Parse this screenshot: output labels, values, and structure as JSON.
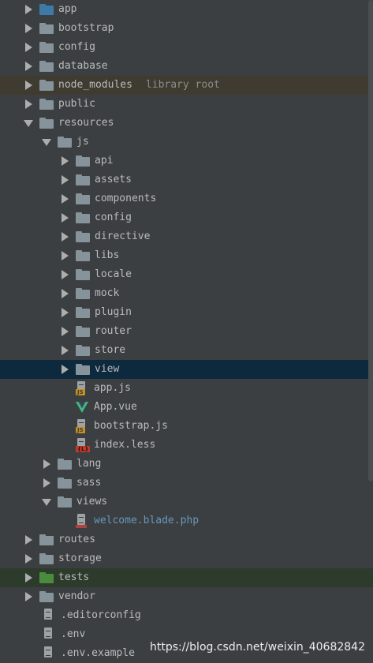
{
  "tree": [
    {
      "label": "app",
      "type": "folder",
      "color": "#3d7aa8",
      "expanded": false
    },
    {
      "label": "bootstrap",
      "type": "folder",
      "color": "#87939a",
      "expanded": false
    },
    {
      "label": "config",
      "type": "folder",
      "color": "#87939a",
      "expanded": false
    },
    {
      "label": "database",
      "type": "folder",
      "color": "#87939a",
      "expanded": false
    },
    {
      "label": "node_modules",
      "hint": "library root",
      "type": "folder",
      "color": "#87939a",
      "expanded": false
    },
    {
      "label": "public",
      "type": "folder",
      "color": "#87939a",
      "expanded": false
    },
    {
      "label": "resources",
      "type": "folder",
      "color": "#87939a",
      "expanded": true
    },
    {
      "label": "js",
      "type": "folder",
      "color": "#87939a",
      "expanded": true
    },
    {
      "label": "api",
      "type": "folder",
      "color": "#87939a",
      "expanded": false
    },
    {
      "label": "assets",
      "type": "folder",
      "color": "#87939a",
      "expanded": false
    },
    {
      "label": "components",
      "type": "folder",
      "color": "#87939a",
      "expanded": false
    },
    {
      "label": "config",
      "type": "folder",
      "color": "#87939a",
      "expanded": false
    },
    {
      "label": "directive",
      "type": "folder",
      "color": "#87939a",
      "expanded": false
    },
    {
      "label": "libs",
      "type": "folder",
      "color": "#87939a",
      "expanded": false
    },
    {
      "label": "locale",
      "type": "folder",
      "color": "#87939a",
      "expanded": false
    },
    {
      "label": "mock",
      "type": "folder",
      "color": "#87939a",
      "expanded": false
    },
    {
      "label": "plugin",
      "type": "folder",
      "color": "#87939a",
      "expanded": false
    },
    {
      "label": "router",
      "type": "folder",
      "color": "#87939a",
      "expanded": false
    },
    {
      "label": "store",
      "type": "folder",
      "color": "#87939a",
      "expanded": false
    },
    {
      "label": "view",
      "type": "folder",
      "color": "#87939a",
      "expanded": false
    },
    {
      "label": "app.js",
      "type": "file",
      "icon": "js-file-icon"
    },
    {
      "label": "App.vue",
      "type": "file",
      "icon": "vue-file-icon"
    },
    {
      "label": "bootstrap.js",
      "type": "file",
      "icon": "js-file-icon"
    },
    {
      "label": "index.less",
      "type": "file",
      "icon": "less-file-icon"
    },
    {
      "label": "lang",
      "type": "folder",
      "color": "#87939a",
      "expanded": false
    },
    {
      "label": "sass",
      "type": "folder",
      "color": "#87939a",
      "expanded": false
    },
    {
      "label": "views",
      "type": "folder",
      "color": "#87939a",
      "expanded": true
    },
    {
      "label": "welcome.blade.php",
      "type": "file",
      "icon": "php-file-icon"
    },
    {
      "label": "routes",
      "type": "folder",
      "color": "#87939a",
      "expanded": false
    },
    {
      "label": "storage",
      "type": "folder",
      "color": "#87939a",
      "expanded": false
    },
    {
      "label": "tests",
      "type": "folder",
      "color": "#4a8c3c",
      "expanded": false
    },
    {
      "label": "vendor",
      "type": "folder",
      "color": "#87939a",
      "expanded": false
    },
    {
      "label": ".editorconfig",
      "type": "file",
      "icon": "text-file-icon"
    },
    {
      "label": ".env",
      "type": "file",
      "icon": "text-file-icon"
    },
    {
      "label": ".env.example",
      "type": "file",
      "icon": "text-file-icon"
    }
  ],
  "badges": {
    "js": "JS",
    "less": "{L}"
  },
  "watermark": "https://blog.csdn.net/weixin_40682842"
}
